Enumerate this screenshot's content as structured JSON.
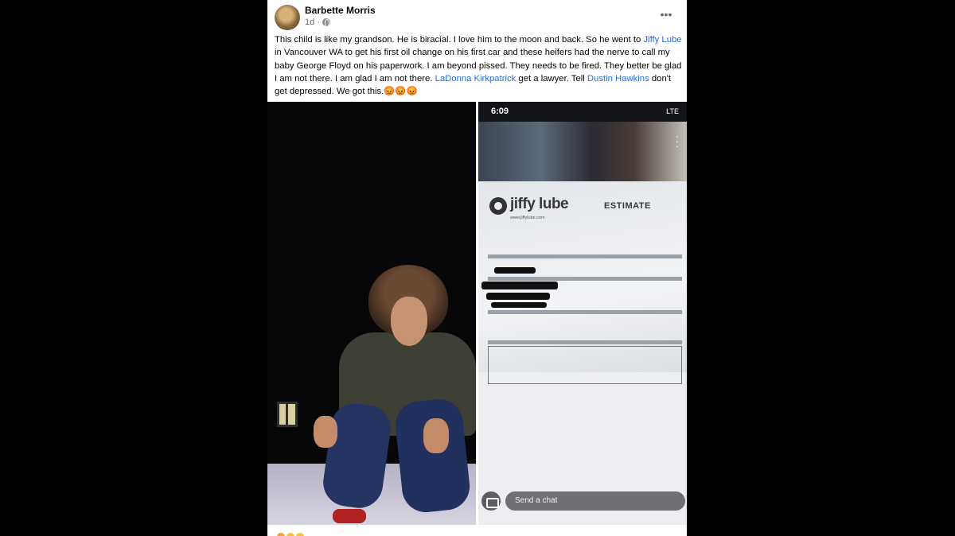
{
  "post": {
    "author": "Barbette Morris",
    "time": "1d",
    "more_icon": "more-horizontal-icon",
    "privacy_icon": "globe-icon",
    "text": {
      "p1": "This child is like my grandson. He is biracial. I love him to the moon and back. So he went to ",
      "link1": "Jiffy Lube",
      "p2": "  in Vancouver WA to get his first oil change on his first car and these heifers had the nerve to call my baby George Floyd on his paperwork. I am beyond pissed. They needs to be fired. They better be glad I am not there. I am glad I am not there. ",
      "link2": "LaDonna Kirkpatrick",
      "p3": " get a lawyer. Tell ",
      "link3": "Dustin Hawkins",
      "p4": " don't get depressed. We got this.",
      "emojis": "😡😡😡"
    },
    "link_color": "#216fdb"
  },
  "phone_screenshot": {
    "status_time": "6:09",
    "status_network": "LTE",
    "receipt": {
      "brand": "jiffy lube",
      "doc_type": "ESTIMATE",
      "url": "www.jiffylube.com"
    },
    "chat_placeholder": "Send a chat"
  }
}
